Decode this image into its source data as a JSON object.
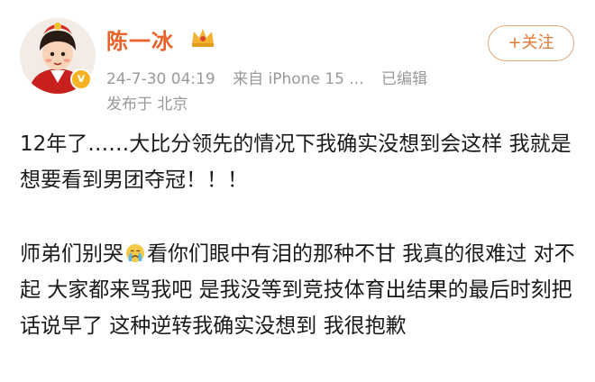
{
  "post": {
    "username": "陈一冰",
    "timestamp": "24-7-30 04:19",
    "source": "来自 iPhone 15 ...",
    "edited": "已编辑",
    "location": "发布于 北京",
    "follow_label": "+关注",
    "verified_badge": "v",
    "paragraph1": "12年了……大比分领先的情况下我确实没想到会这样 我就是想要看到男团夺冠！！！",
    "paragraph2_before_emoji": "师弟们别哭",
    "paragraph2_emoji": "crying-face-icon",
    "paragraph2_after_emoji": "看你们眼中有泪的那种不甘 我真的很难过 对不起 大家都来骂我吧 是我没等到竞技体育出结果的最后时刻把话说早了 这种逆转我确实没想到 我很抱歉"
  },
  "colors": {
    "username": "#e8632b",
    "meta": "#999999",
    "follow": "#e07a36",
    "badge": "#f5b324"
  }
}
